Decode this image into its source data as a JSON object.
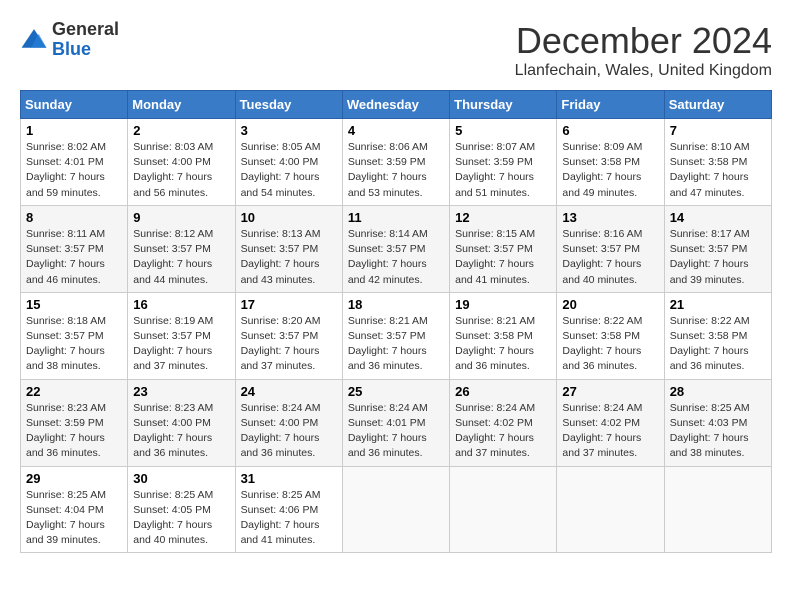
{
  "logo": {
    "general": "General",
    "blue": "Blue"
  },
  "title": "December 2024",
  "location": "Llanfechain, Wales, United Kingdom",
  "days_header": [
    "Sunday",
    "Monday",
    "Tuesday",
    "Wednesday",
    "Thursday",
    "Friday",
    "Saturday"
  ],
  "weeks": [
    [
      {
        "day": "1",
        "sunrise": "8:02 AM",
        "sunset": "4:01 PM",
        "daylight": "7 hours and 59 minutes."
      },
      {
        "day": "2",
        "sunrise": "8:03 AM",
        "sunset": "4:00 PM",
        "daylight": "7 hours and 56 minutes."
      },
      {
        "day": "3",
        "sunrise": "8:05 AM",
        "sunset": "4:00 PM",
        "daylight": "7 hours and 54 minutes."
      },
      {
        "day": "4",
        "sunrise": "8:06 AM",
        "sunset": "3:59 PM",
        "daylight": "7 hours and 53 minutes."
      },
      {
        "day": "5",
        "sunrise": "8:07 AM",
        "sunset": "3:59 PM",
        "daylight": "7 hours and 51 minutes."
      },
      {
        "day": "6",
        "sunrise": "8:09 AM",
        "sunset": "3:58 PM",
        "daylight": "7 hours and 49 minutes."
      },
      {
        "day": "7",
        "sunrise": "8:10 AM",
        "sunset": "3:58 PM",
        "daylight": "7 hours and 47 minutes."
      }
    ],
    [
      {
        "day": "8",
        "sunrise": "8:11 AM",
        "sunset": "3:57 PM",
        "daylight": "7 hours and 46 minutes."
      },
      {
        "day": "9",
        "sunrise": "8:12 AM",
        "sunset": "3:57 PM",
        "daylight": "7 hours and 44 minutes."
      },
      {
        "day": "10",
        "sunrise": "8:13 AM",
        "sunset": "3:57 PM",
        "daylight": "7 hours and 43 minutes."
      },
      {
        "day": "11",
        "sunrise": "8:14 AM",
        "sunset": "3:57 PM",
        "daylight": "7 hours and 42 minutes."
      },
      {
        "day": "12",
        "sunrise": "8:15 AM",
        "sunset": "3:57 PM",
        "daylight": "7 hours and 41 minutes."
      },
      {
        "day": "13",
        "sunrise": "8:16 AM",
        "sunset": "3:57 PM",
        "daylight": "7 hours and 40 minutes."
      },
      {
        "day": "14",
        "sunrise": "8:17 AM",
        "sunset": "3:57 PM",
        "daylight": "7 hours and 39 minutes."
      }
    ],
    [
      {
        "day": "15",
        "sunrise": "8:18 AM",
        "sunset": "3:57 PM",
        "daylight": "7 hours and 38 minutes."
      },
      {
        "day": "16",
        "sunrise": "8:19 AM",
        "sunset": "3:57 PM",
        "daylight": "7 hours and 37 minutes."
      },
      {
        "day": "17",
        "sunrise": "8:20 AM",
        "sunset": "3:57 PM",
        "daylight": "7 hours and 37 minutes."
      },
      {
        "day": "18",
        "sunrise": "8:21 AM",
        "sunset": "3:57 PM",
        "daylight": "7 hours and 36 minutes."
      },
      {
        "day": "19",
        "sunrise": "8:21 AM",
        "sunset": "3:58 PM",
        "daylight": "7 hours and 36 minutes."
      },
      {
        "day": "20",
        "sunrise": "8:22 AM",
        "sunset": "3:58 PM",
        "daylight": "7 hours and 36 minutes."
      },
      {
        "day": "21",
        "sunrise": "8:22 AM",
        "sunset": "3:58 PM",
        "daylight": "7 hours and 36 minutes."
      }
    ],
    [
      {
        "day": "22",
        "sunrise": "8:23 AM",
        "sunset": "3:59 PM",
        "daylight": "7 hours and 36 minutes."
      },
      {
        "day": "23",
        "sunrise": "8:23 AM",
        "sunset": "4:00 PM",
        "daylight": "7 hours and 36 minutes."
      },
      {
        "day": "24",
        "sunrise": "8:24 AM",
        "sunset": "4:00 PM",
        "daylight": "7 hours and 36 minutes."
      },
      {
        "day": "25",
        "sunrise": "8:24 AM",
        "sunset": "4:01 PM",
        "daylight": "7 hours and 36 minutes."
      },
      {
        "day": "26",
        "sunrise": "8:24 AM",
        "sunset": "4:02 PM",
        "daylight": "7 hours and 37 minutes."
      },
      {
        "day": "27",
        "sunrise": "8:24 AM",
        "sunset": "4:02 PM",
        "daylight": "7 hours and 37 minutes."
      },
      {
        "day": "28",
        "sunrise": "8:25 AM",
        "sunset": "4:03 PM",
        "daylight": "7 hours and 38 minutes."
      }
    ],
    [
      {
        "day": "29",
        "sunrise": "8:25 AM",
        "sunset": "4:04 PM",
        "daylight": "7 hours and 39 minutes."
      },
      {
        "day": "30",
        "sunrise": "8:25 AM",
        "sunset": "4:05 PM",
        "daylight": "7 hours and 40 minutes."
      },
      {
        "day": "31",
        "sunrise": "8:25 AM",
        "sunset": "4:06 PM",
        "daylight": "7 hours and 41 minutes."
      },
      null,
      null,
      null,
      null
    ]
  ],
  "labels": {
    "sunrise": "Sunrise:",
    "sunset": "Sunset:",
    "daylight": "Daylight:"
  }
}
